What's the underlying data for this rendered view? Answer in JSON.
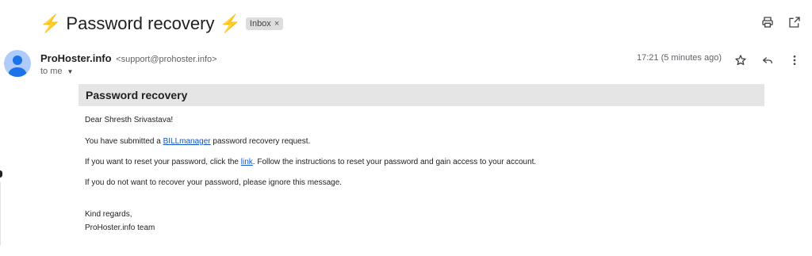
{
  "email": {
    "subject_prefix_icon": "⚡",
    "subject": "Password recovery",
    "subject_suffix_icon": "⚡",
    "label": "Inbox",
    "label_close": "×",
    "sender_name": "ProHoster.info",
    "sender_email": "<support@prohoster.info>",
    "recipient": "to me",
    "time": "17:21 (5 minutes ago)"
  },
  "message": {
    "banner_title": "Password recovery",
    "greeting": "Dear Shresth Srivastava!",
    "line1_before": "You have submitted a ",
    "line1_link": "BILLmanager",
    "line1_after": " password recovery request.",
    "line2_before": "If you want to reset your password, click the ",
    "line2_link": "link",
    "line2_after": ". Follow the instructions to reset your password and gain access to your account.",
    "line3": "If you do not want to recover your password, please ignore this message.",
    "closing1": "Kind regards,",
    "closing2": "ProHoster.info team"
  },
  "icons": {
    "print": "printer-icon",
    "open_new": "open-in-new-window-icon",
    "star": "star-icon",
    "reply": "reply-icon",
    "more": "more-vert-icon",
    "bolt": "lightning-bolt-icon"
  },
  "colors": {
    "bolt": "#f2b600",
    "link": "#1155cc",
    "banner_bg": "#e5e5e5",
    "avatar_bg": "#aecbfa",
    "avatar_fg": "#1a73e8"
  }
}
